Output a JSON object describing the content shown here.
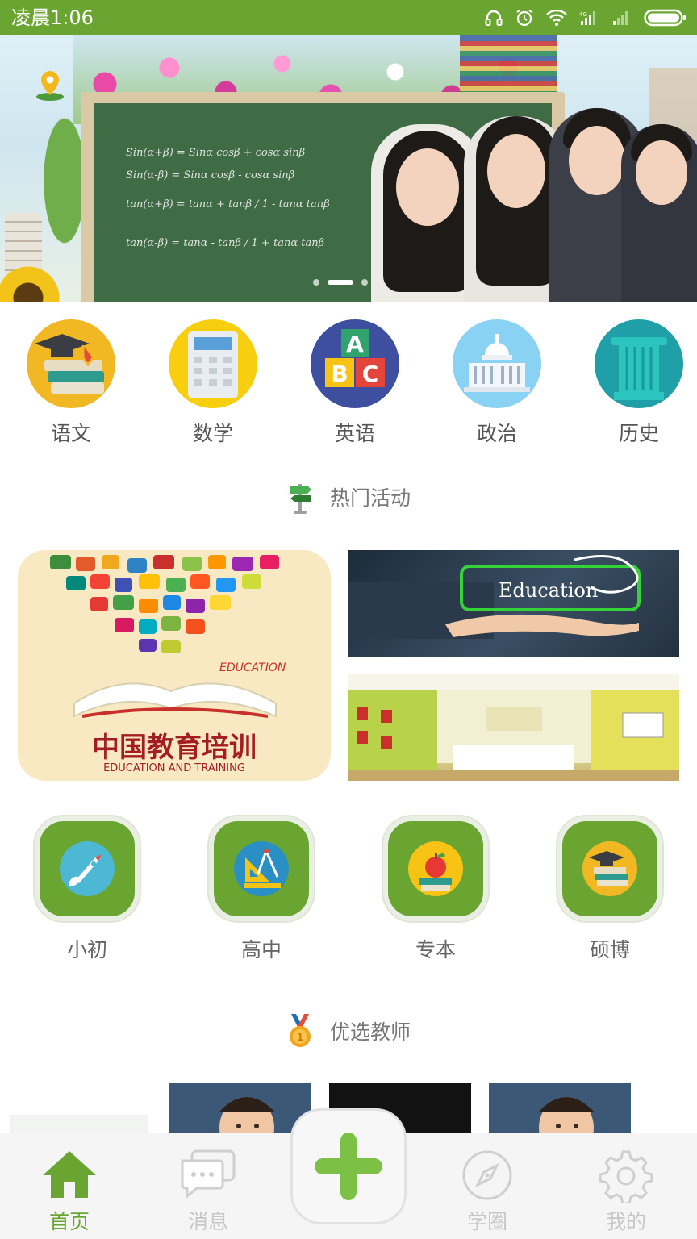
{
  "status_bar": {
    "time": "凌晨1:06",
    "icons": [
      "headphones-icon",
      "alarm-icon",
      "wifi-icon",
      "signal-icon",
      "signal-icon-2",
      "battery-icon"
    ]
  },
  "banner": {
    "chalk_lines": [
      "Sin(α+β) = Sinα cosβ + cosα sinβ",
      "Sin(α-β) = Sinα cosβ - cosα sinβ",
      "tan(α+β) = tanα + tanβ / 1 - tanα tanβ",
      "tan(α-β) = tanα - tanβ / 1 + tanα tanβ"
    ],
    "page_count": 3,
    "active_page": 2
  },
  "subjects": [
    {
      "label": "语文",
      "color": "#f2b824",
      "icon": "graduation-books-icon"
    },
    {
      "label": "数学",
      "color": "#f7cf0f",
      "icon": "calculator-icon"
    },
    {
      "label": "英语",
      "color": "#3d4f9e",
      "icon": "abc-blocks-icon"
    },
    {
      "label": "政治",
      "color": "#89d2f4",
      "icon": "capitol-building-icon"
    },
    {
      "label": "历史",
      "color": "#1fa0a8",
      "icon": "column-icon"
    }
  ],
  "hot": {
    "title": "热门活动",
    "main_card_title": "中国教育培训",
    "main_card_subtitle": "EDUCATION AND TRAINING",
    "main_card_word": "EDUCATION",
    "top_card_word": "Education"
  },
  "levels": [
    {
      "label": "小初",
      "icon": "rocket-icon"
    },
    {
      "label": "高中",
      "icon": "ruler-compass-icon"
    },
    {
      "label": "专本",
      "icon": "apple-books-icon"
    },
    {
      "label": "硕博",
      "icon": "graduation-books-icon"
    }
  ],
  "teachers": {
    "title": "优选教师"
  },
  "nav": {
    "items": [
      {
        "label": "首页",
        "icon": "home-icon",
        "active": true
      },
      {
        "label": "消息",
        "icon": "chat-icon",
        "active": false
      },
      {
        "label": "学圈",
        "icon": "compass-icon",
        "active": false
      },
      {
        "label": "我的",
        "icon": "gear-icon",
        "active": false
      }
    ],
    "center_icon": "plus-icon"
  },
  "colors": {
    "brand_green": "#6aa532",
    "text_gray": "#555555",
    "nav_inactive": "#c7c7c7"
  }
}
